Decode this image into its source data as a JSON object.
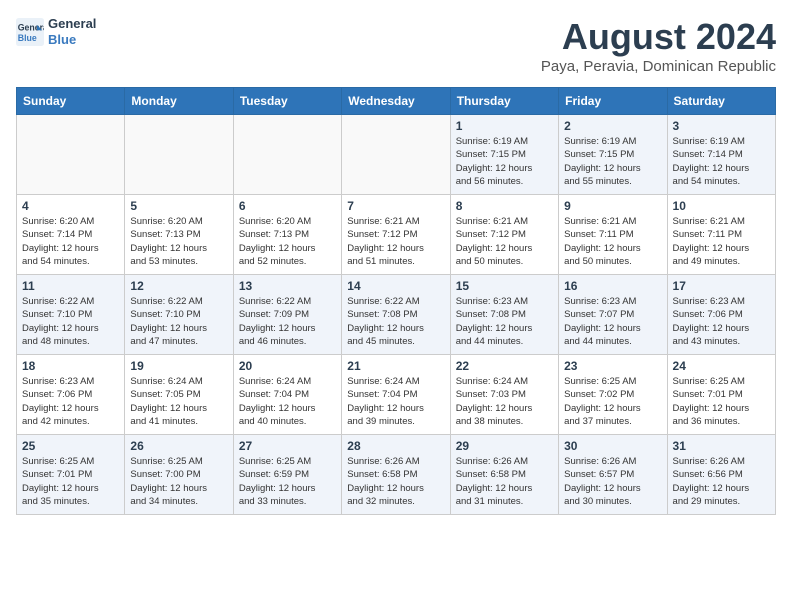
{
  "header": {
    "logo_line1": "General",
    "logo_line2": "Blue",
    "title": "August 2024",
    "subtitle": "Paya, Peravia, Dominican Republic"
  },
  "weekdays": [
    "Sunday",
    "Monday",
    "Tuesday",
    "Wednesday",
    "Thursday",
    "Friday",
    "Saturday"
  ],
  "weeks": [
    [
      {
        "day": "",
        "info": ""
      },
      {
        "day": "",
        "info": ""
      },
      {
        "day": "",
        "info": ""
      },
      {
        "day": "",
        "info": ""
      },
      {
        "day": "1",
        "info": "Sunrise: 6:19 AM\nSunset: 7:15 PM\nDaylight: 12 hours\nand 56 minutes."
      },
      {
        "day": "2",
        "info": "Sunrise: 6:19 AM\nSunset: 7:15 PM\nDaylight: 12 hours\nand 55 minutes."
      },
      {
        "day": "3",
        "info": "Sunrise: 6:19 AM\nSunset: 7:14 PM\nDaylight: 12 hours\nand 54 minutes."
      }
    ],
    [
      {
        "day": "4",
        "info": "Sunrise: 6:20 AM\nSunset: 7:14 PM\nDaylight: 12 hours\nand 54 minutes."
      },
      {
        "day": "5",
        "info": "Sunrise: 6:20 AM\nSunset: 7:13 PM\nDaylight: 12 hours\nand 53 minutes."
      },
      {
        "day": "6",
        "info": "Sunrise: 6:20 AM\nSunset: 7:13 PM\nDaylight: 12 hours\nand 52 minutes."
      },
      {
        "day": "7",
        "info": "Sunrise: 6:21 AM\nSunset: 7:12 PM\nDaylight: 12 hours\nand 51 minutes."
      },
      {
        "day": "8",
        "info": "Sunrise: 6:21 AM\nSunset: 7:12 PM\nDaylight: 12 hours\nand 50 minutes."
      },
      {
        "day": "9",
        "info": "Sunrise: 6:21 AM\nSunset: 7:11 PM\nDaylight: 12 hours\nand 50 minutes."
      },
      {
        "day": "10",
        "info": "Sunrise: 6:21 AM\nSunset: 7:11 PM\nDaylight: 12 hours\nand 49 minutes."
      }
    ],
    [
      {
        "day": "11",
        "info": "Sunrise: 6:22 AM\nSunset: 7:10 PM\nDaylight: 12 hours\nand 48 minutes."
      },
      {
        "day": "12",
        "info": "Sunrise: 6:22 AM\nSunset: 7:10 PM\nDaylight: 12 hours\nand 47 minutes."
      },
      {
        "day": "13",
        "info": "Sunrise: 6:22 AM\nSunset: 7:09 PM\nDaylight: 12 hours\nand 46 minutes."
      },
      {
        "day": "14",
        "info": "Sunrise: 6:22 AM\nSunset: 7:08 PM\nDaylight: 12 hours\nand 45 minutes."
      },
      {
        "day": "15",
        "info": "Sunrise: 6:23 AM\nSunset: 7:08 PM\nDaylight: 12 hours\nand 44 minutes."
      },
      {
        "day": "16",
        "info": "Sunrise: 6:23 AM\nSunset: 7:07 PM\nDaylight: 12 hours\nand 44 minutes."
      },
      {
        "day": "17",
        "info": "Sunrise: 6:23 AM\nSunset: 7:06 PM\nDaylight: 12 hours\nand 43 minutes."
      }
    ],
    [
      {
        "day": "18",
        "info": "Sunrise: 6:23 AM\nSunset: 7:06 PM\nDaylight: 12 hours\nand 42 minutes."
      },
      {
        "day": "19",
        "info": "Sunrise: 6:24 AM\nSunset: 7:05 PM\nDaylight: 12 hours\nand 41 minutes."
      },
      {
        "day": "20",
        "info": "Sunrise: 6:24 AM\nSunset: 7:04 PM\nDaylight: 12 hours\nand 40 minutes."
      },
      {
        "day": "21",
        "info": "Sunrise: 6:24 AM\nSunset: 7:04 PM\nDaylight: 12 hours\nand 39 minutes."
      },
      {
        "day": "22",
        "info": "Sunrise: 6:24 AM\nSunset: 7:03 PM\nDaylight: 12 hours\nand 38 minutes."
      },
      {
        "day": "23",
        "info": "Sunrise: 6:25 AM\nSunset: 7:02 PM\nDaylight: 12 hours\nand 37 minutes."
      },
      {
        "day": "24",
        "info": "Sunrise: 6:25 AM\nSunset: 7:01 PM\nDaylight: 12 hours\nand 36 minutes."
      }
    ],
    [
      {
        "day": "25",
        "info": "Sunrise: 6:25 AM\nSunset: 7:01 PM\nDaylight: 12 hours\nand 35 minutes."
      },
      {
        "day": "26",
        "info": "Sunrise: 6:25 AM\nSunset: 7:00 PM\nDaylight: 12 hours\nand 34 minutes."
      },
      {
        "day": "27",
        "info": "Sunrise: 6:25 AM\nSunset: 6:59 PM\nDaylight: 12 hours\nand 33 minutes."
      },
      {
        "day": "28",
        "info": "Sunrise: 6:26 AM\nSunset: 6:58 PM\nDaylight: 12 hours\nand 32 minutes."
      },
      {
        "day": "29",
        "info": "Sunrise: 6:26 AM\nSunset: 6:58 PM\nDaylight: 12 hours\nand 31 minutes."
      },
      {
        "day": "30",
        "info": "Sunrise: 6:26 AM\nSunset: 6:57 PM\nDaylight: 12 hours\nand 30 minutes."
      },
      {
        "day": "31",
        "info": "Sunrise: 6:26 AM\nSunset: 6:56 PM\nDaylight: 12 hours\nand 29 minutes."
      }
    ]
  ]
}
